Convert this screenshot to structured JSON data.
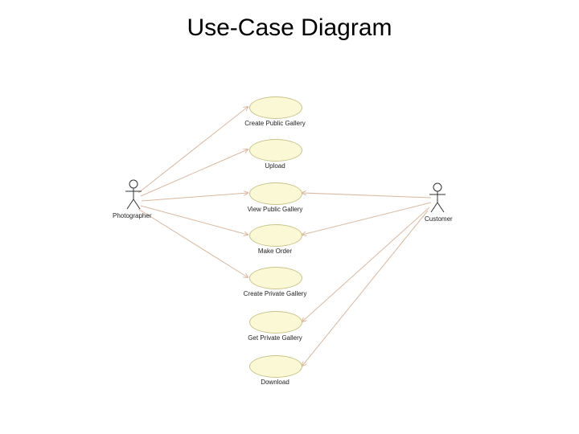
{
  "title": "Use-Case Diagram",
  "actors": {
    "left": {
      "label": "Photographer"
    },
    "right": {
      "label": "Customer"
    }
  },
  "usecases": {
    "u1": {
      "label": "Create Public Gallery"
    },
    "u2": {
      "label": "Upload"
    },
    "u3": {
      "label": "View Public Gallery"
    },
    "u4": {
      "label": "Make Order"
    },
    "u5": {
      "label": "Create Private Gallery"
    },
    "u6": {
      "label": "Get Private Gallery"
    },
    "u7": {
      "label": "Download"
    }
  },
  "chart_data": {
    "type": "uml-use-case",
    "actors": [
      "Photographer",
      "Customer"
    ],
    "use_cases": [
      "Create Public Gallery",
      "Upload",
      "View Public Gallery",
      "Make Order",
      "Create Private Gallery",
      "Get Private Gallery",
      "Download"
    ],
    "associations": [
      {
        "actor": "Photographer",
        "use_case": "Create Public Gallery"
      },
      {
        "actor": "Photographer",
        "use_case": "Upload"
      },
      {
        "actor": "Photographer",
        "use_case": "View Public Gallery"
      },
      {
        "actor": "Photographer",
        "use_case": "Make Order"
      },
      {
        "actor": "Photographer",
        "use_case": "Create Private Gallery"
      },
      {
        "actor": "Customer",
        "use_case": "View Public Gallery"
      },
      {
        "actor": "Customer",
        "use_case": "Make Order"
      },
      {
        "actor": "Customer",
        "use_case": "Get Private Gallery"
      },
      {
        "actor": "Customer",
        "use_case": "Download"
      }
    ]
  }
}
